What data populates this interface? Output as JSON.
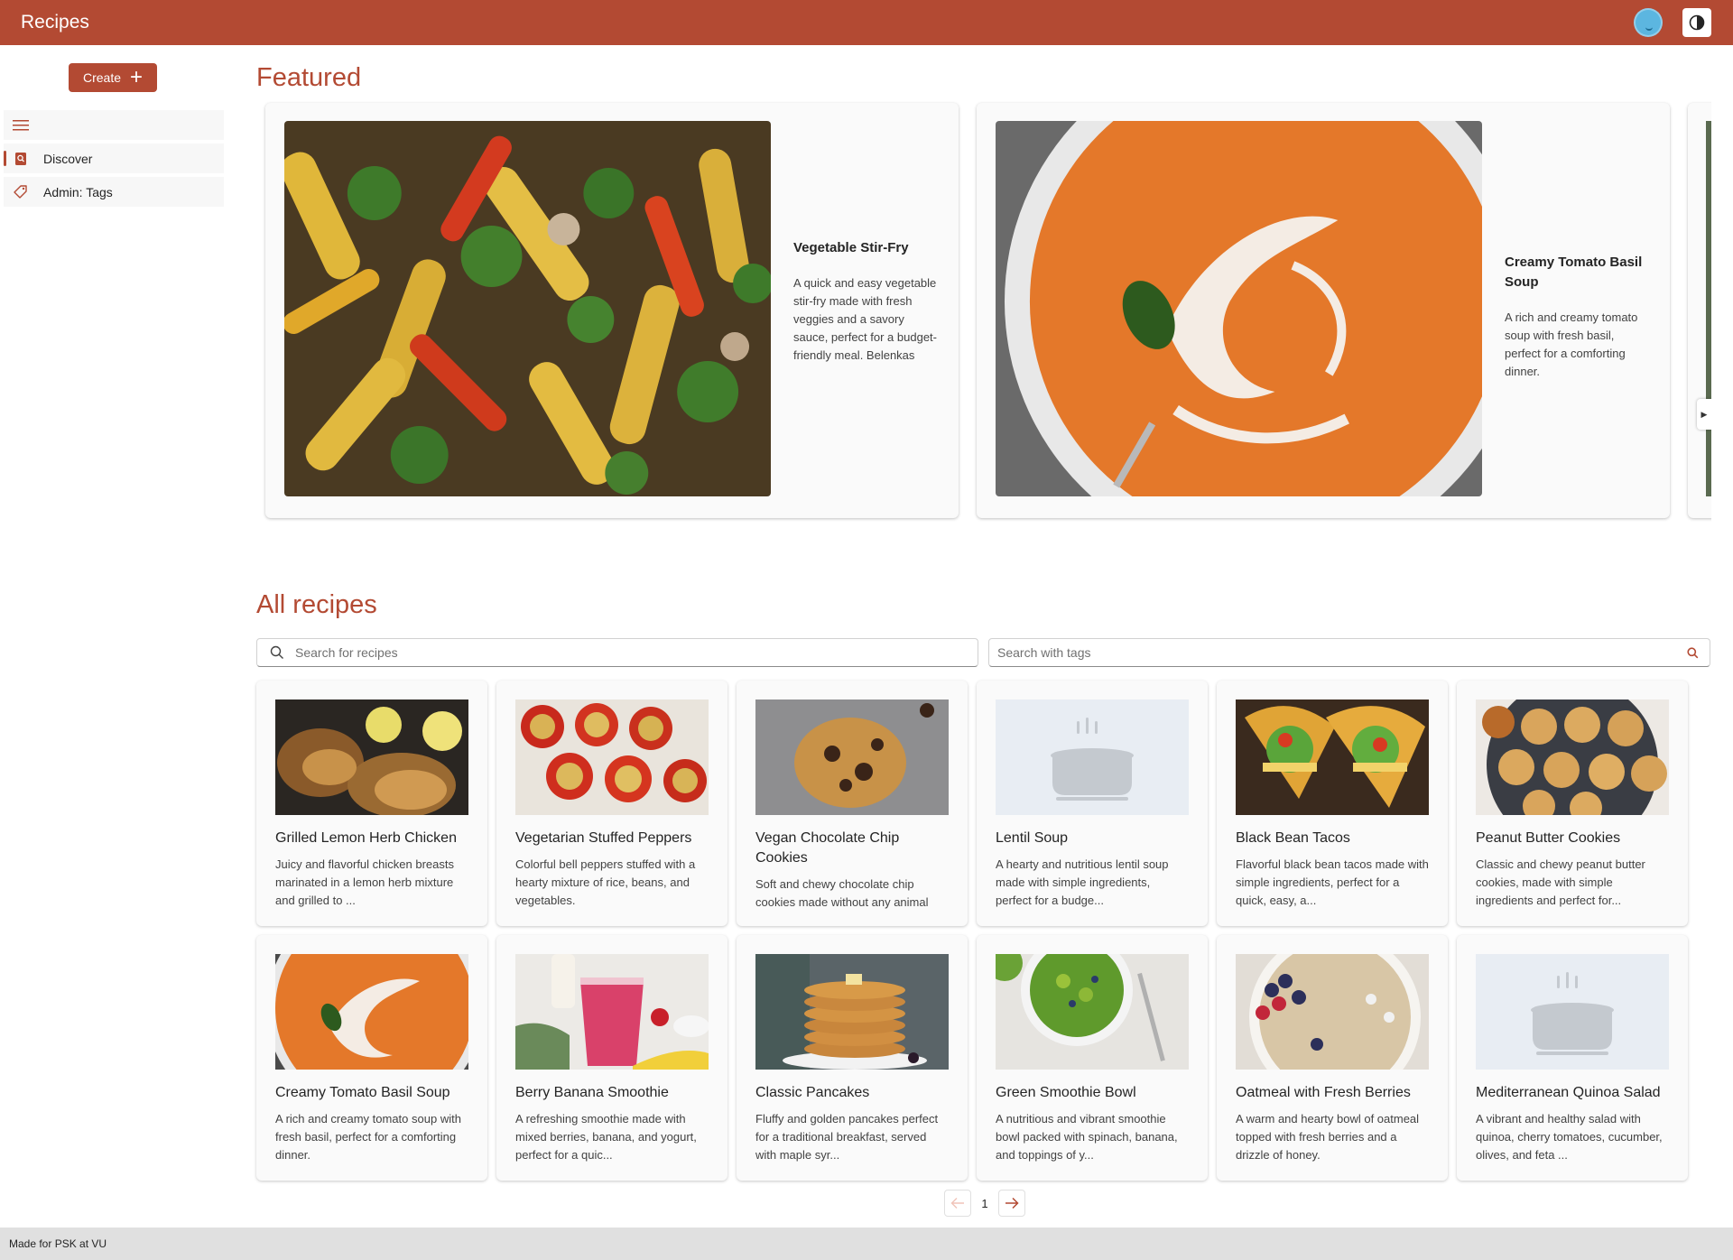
{
  "app": {
    "title": "Recipes"
  },
  "header": {
    "avatar_icon": "user-avatar-icon",
    "theme_icon": "contrast-icon"
  },
  "sidebar": {
    "create_label": "Create",
    "items": [
      {
        "label": "Discover",
        "icon": "book-search-icon",
        "active": true
      },
      {
        "label": "Admin: Tags",
        "icon": "tag-icon",
        "active": false
      }
    ]
  },
  "featured": {
    "title": "Featured",
    "cards": [
      {
        "title": "Vegetable Stir-Fry",
        "description": "A quick and easy vegetable stir-fry made with fresh veggies and a savory sauce, perfect for a budget-friendly meal. Belenkas",
        "image": "vegetable stir-fry"
      },
      {
        "title": "Creamy Tomato Basil Soup",
        "description": "A rich and creamy tomato soup with fresh basil, perfect for a comforting dinner.",
        "image": "tomato soup"
      }
    ]
  },
  "all_recipes": {
    "title": "All recipes",
    "search_placeholder": "Search for recipes",
    "tags_placeholder": "Search with tags",
    "recipes": [
      {
        "title": "Grilled Lemon Herb Chicken",
        "description": "Juicy and flavorful chicken breasts marinated in a lemon herb mixture and grilled to ...",
        "image": "chicken"
      },
      {
        "title": "Vegetarian Stuffed Peppers",
        "description": "Colorful bell peppers stuffed with a hearty mixture of rice, beans, and vegetables.",
        "image": "peppers"
      },
      {
        "title": "Vegan Chocolate Chip Cookies",
        "description": "Soft and chewy chocolate chip cookies made without any animal products, perfect for a ...",
        "image": "cookie"
      },
      {
        "title": "Lentil Soup",
        "description": "A hearty and nutritious lentil soup made with simple ingredients, perfect for a budge...",
        "image": "placeholder"
      },
      {
        "title": "Black Bean Tacos",
        "description": "Flavorful black bean tacos made with simple ingredients, perfect for a quick, easy, a...",
        "image": "tacos"
      },
      {
        "title": "Peanut Butter Cookies",
        "description": "Classic and chewy peanut butter cookies, made with simple ingredients and perfect for...",
        "image": "pb-cookies"
      },
      {
        "title": "Creamy Tomato Basil Soup",
        "description": "A rich and creamy tomato soup with fresh basil, perfect for a comforting dinner.",
        "image": "tomato soup"
      },
      {
        "title": "Berry Banana Smoothie",
        "description": "A refreshing smoothie made with mixed berries, banana, and yogurt, perfect for a quic...",
        "image": "smoothie"
      },
      {
        "title": "Classic Pancakes",
        "description": "Fluffy and golden pancakes perfect for a traditional breakfast, served with maple syr...",
        "image": "pancakes"
      },
      {
        "title": "Green Smoothie Bowl",
        "description": "A nutritious and vibrant smoothie bowl packed with spinach, banana, and toppings of y...",
        "image": "green bowl"
      },
      {
        "title": "Oatmeal with Fresh Berries",
        "description": "A warm and hearty bowl of oatmeal topped with fresh berries and a drizzle of honey.",
        "image": "oatmeal"
      },
      {
        "title": "Mediterranean Quinoa Salad",
        "description": "A vibrant and healthy salad with quinoa, cherry tomatoes, cucumber, olives, and feta ...",
        "image": "placeholder"
      }
    ]
  },
  "pagination": {
    "current": "1"
  },
  "footer": {
    "text": "Made for PSK at VU"
  },
  "colors": {
    "brand": "#b34a33",
    "card": "#fafafa",
    "footer": "#e0e0e0"
  }
}
